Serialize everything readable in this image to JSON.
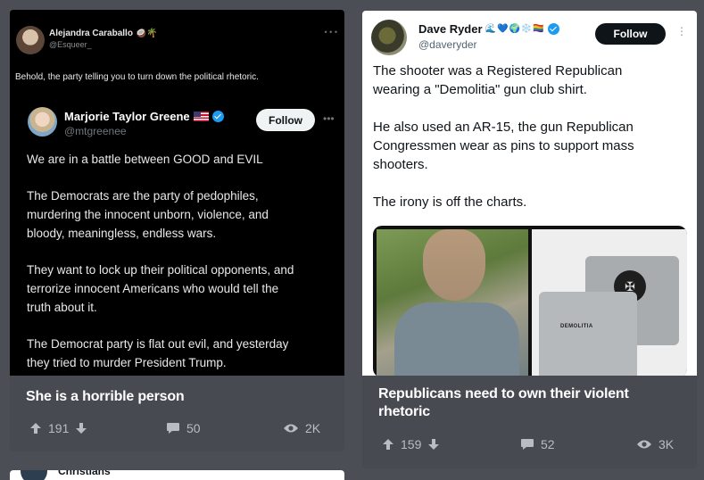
{
  "posts": [
    {
      "tweet": {
        "author_name": "Alejandra Caraballo",
        "author_emoji": "🥥🌴",
        "author_handle": "@Esqueer_",
        "text": "Behold, the party telling you to turn down the political rhetoric.",
        "quote": {
          "author_name": "Marjorie Taylor Greene",
          "author_handle": "@mtgreenee",
          "follow_label": "Follow",
          "paragraphs": [
            "We are in a battle between GOOD and EVIL",
            "The Democrats are the party of pedophiles,\nmurdering the innocent unborn, violence, and\nbloody, meaningless, endless wars.",
            "They want to lock up their political opponents, and\nterrorize innocent Americans who would tell the\ntruth about it.",
            "The Democrat party is flat out evil, and yesterday\nthey tried to murder President Trump."
          ]
        }
      },
      "title": "She is a horrible person",
      "upvotes": "191",
      "comments": "50",
      "views": "2K"
    },
    {
      "tweet": {
        "author_name": "Dave Ryder",
        "author_emoji": "🌊💙🌍❄️🏳️‍🌈",
        "author_handle": "@daveryder",
        "follow_label": "Follow",
        "paragraphs": [
          "The shooter was a Registered Republican\nwearing a \"Demolitia\" gun club shirt.",
          "He also used an AR-15, the gun Republican\nCongressmen wear as pins to support mass\nshooters.",
          "The irony is off the charts."
        ],
        "shirt_text": "DEMOLITIA"
      },
      "title": "Republicans need to own their violent rhetoric",
      "upvotes": "159",
      "comments": "52",
      "views": "3K"
    },
    {
      "partial_text": "Christians"
    }
  ],
  "colors": {
    "page_bg": "#4b4e55",
    "card_footer": "#474a51",
    "verified_blue": "#1d9bf0",
    "stat_text": "#b9bcc2"
  },
  "icons": [
    "arrow-up-icon",
    "arrow-down-icon",
    "comment-icon",
    "eye-icon",
    "verified-icon",
    "more-icon",
    "flag-icon"
  ]
}
